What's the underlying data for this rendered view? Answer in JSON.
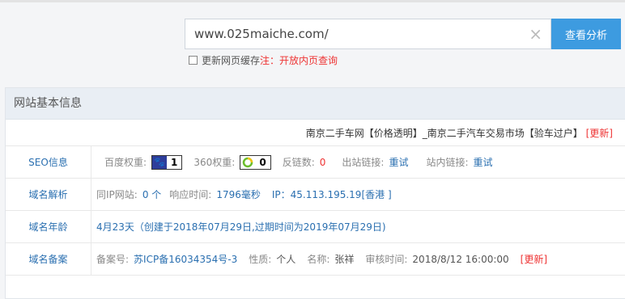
{
  "search": {
    "value": "www.025maiche.com/",
    "clear_icon": "×",
    "button": "查看分析"
  },
  "cache": {
    "label": "更新网页缓存",
    "note": "注：开放内页查询"
  },
  "panel": {
    "title": "网站基本信息"
  },
  "site_title": "南京二手车网【价格透明】_南京二手汽车交易市场【验车过户】",
  "update_label": "[更新]",
  "seo": {
    "label": "SEO信息",
    "baidu_label": "百度权重:",
    "baidu_value": "1",
    "w360_label": "360权重:",
    "w360_value": "0",
    "backlinks_label": "反链数:",
    "backlinks_value": "0",
    "outlinks_label": "出站链接:",
    "outlinks_value": "重试",
    "inlinks_label": "站内链接:",
    "inlinks_value": "重试"
  },
  "dns": {
    "label": "域名解析",
    "sameip_label": "同IP网站:",
    "sameip_value": "0 个",
    "resp_label": "响应时间:",
    "resp_value": "1796毫秒",
    "ip_value": "IP：45.113.195.19[香港 ]"
  },
  "age": {
    "label": "域名年龄",
    "value": "4月23天（创建于2018年07月29日,过期时间为2019年07月29日)"
  },
  "icp": {
    "label": "域名备案",
    "no_label": "备案号:",
    "no_value": "苏ICP备16034354号-3",
    "nature_label": "性质:",
    "nature_value": "个人",
    "name_label": "名称:",
    "name_value": "张祥",
    "time_label": "审核时间:",
    "time_value": "2018/8/12 16:00:00"
  }
}
